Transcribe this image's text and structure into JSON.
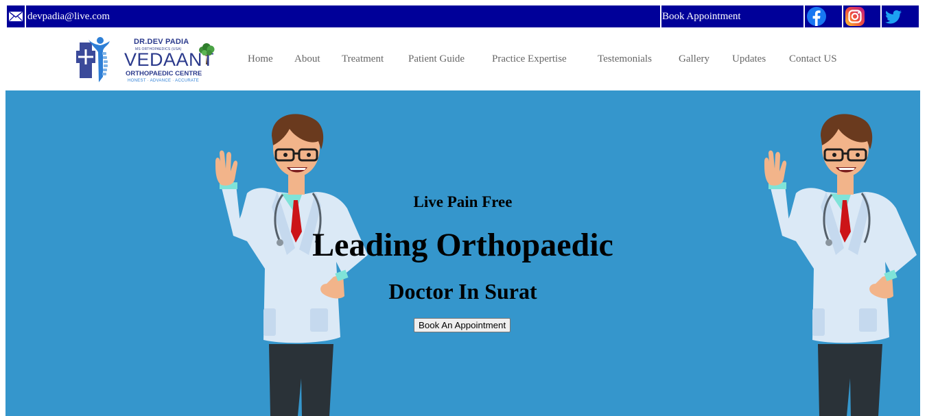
{
  "topbar": {
    "email": "devpadia@live.com",
    "book_label": "Book Appointment",
    "icons": [
      "mail-icon",
      "facebook-icon",
      "instagram-icon",
      "twitter-icon"
    ]
  },
  "logo": {
    "line1": "DR.DEV PADIA",
    "line2": "MS ORTHOPAEDICS (USA)",
    "line3": "VEDAANT",
    "line4": "ORTHOPAEDIC CENTRE",
    "line5": "HONEST · ADVANCE · ACCURATE"
  },
  "nav": {
    "items": [
      "Home",
      "About",
      "Treatment",
      "Patient Guide",
      "Practice Expertise",
      "Testemonials",
      "Gallery",
      "Updates",
      "Contact US"
    ]
  },
  "hero": {
    "kicker": "Live Pain Free",
    "title": "Leading Orthopaedic",
    "subtitle": "Doctor In Surat",
    "button_label": "Book An Appointment"
  },
  "colors": {
    "topbar_bg": "#000099",
    "hero_bg": "#3596cc",
    "nav_text": "#666666",
    "brand_navy": "#2b3a8c"
  }
}
